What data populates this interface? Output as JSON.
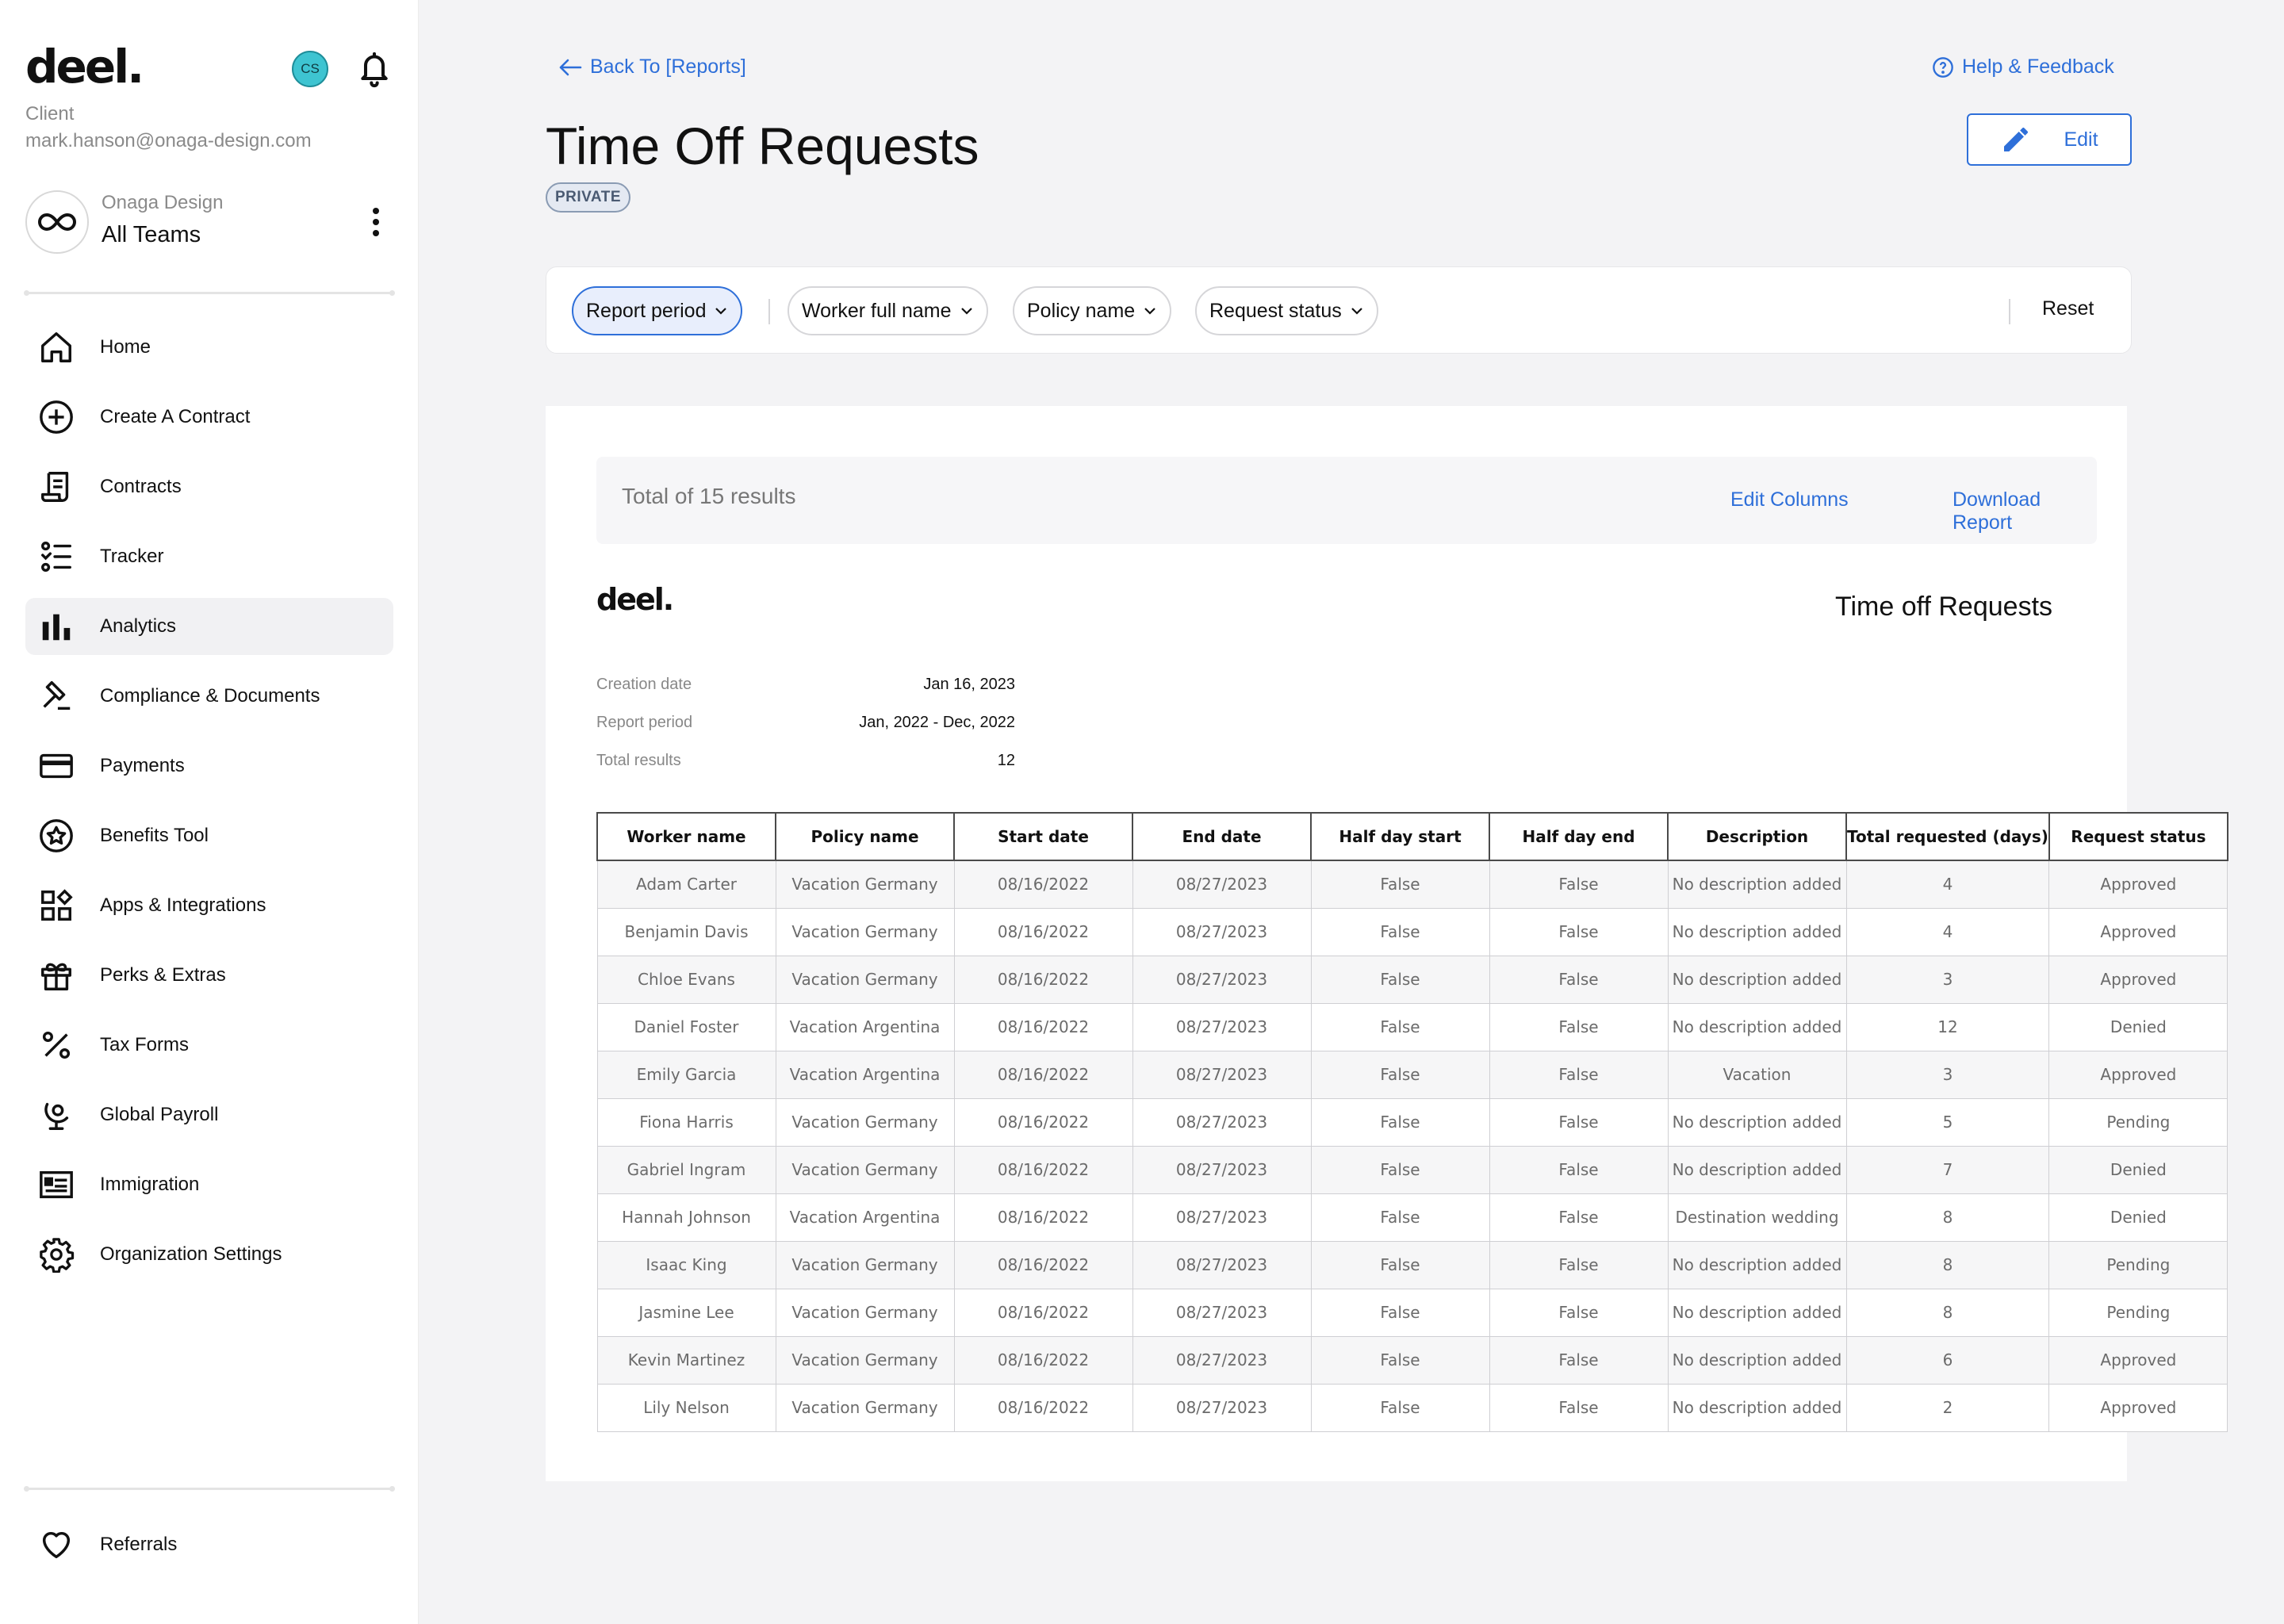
{
  "sidebar": {
    "logo": "deel.",
    "avatar_initials": "CS",
    "role": "Client",
    "email": "mark.hanson@onaga-design.com",
    "team": {
      "org": "Onaga Design",
      "name": "All Teams"
    },
    "nav": [
      {
        "label": "Home",
        "icon": "home-icon"
      },
      {
        "label": "Create A Contract",
        "icon": "plus-circle-icon"
      },
      {
        "label": "Contracts",
        "icon": "scroll-icon"
      },
      {
        "label": "Tracker",
        "icon": "checklist-icon"
      },
      {
        "label": "Analytics",
        "icon": "bar-chart-icon",
        "active": true
      },
      {
        "label": "Compliance & Documents",
        "icon": "gavel-icon"
      },
      {
        "label": "Payments",
        "icon": "credit-card-icon"
      },
      {
        "label": "Benefits Tool",
        "icon": "star-badge-icon"
      },
      {
        "label": "Apps & Integrations",
        "icon": "apps-grid-icon"
      },
      {
        "label": "Perks & Extras",
        "icon": "gift-icon"
      },
      {
        "label": "Tax Forms",
        "icon": "percent-icon"
      },
      {
        "label": "Global Payroll",
        "icon": "globe-pin-icon"
      },
      {
        "label": "Immigration",
        "icon": "id-card-icon"
      },
      {
        "label": "Organization Settings",
        "icon": "gear-icon"
      }
    ],
    "referrals": "Referrals"
  },
  "header": {
    "back_label": "Back To [Reports]",
    "help_label": "Help & Feedback",
    "title": "Time Off Requests",
    "badge": "PRIVATE",
    "edit_label": "Edit"
  },
  "filters": {
    "chips": [
      "Report period",
      "Worker full name",
      "Policy name",
      "Request status"
    ],
    "reset_label": "Reset"
  },
  "report": {
    "total_results_text": "Total of 15 results",
    "edit_columns_label": "Edit Columns",
    "download_label": "Download Report",
    "logo": "deel.",
    "title": "Time off Requests",
    "meta": [
      {
        "label": "Creation date",
        "value": "Jan 16, 2023"
      },
      {
        "label": "Report period",
        "value": "Jan, 2022 - Dec, 2022"
      },
      {
        "label": "Total results",
        "value": "12"
      }
    ],
    "columns": [
      "Worker name",
      "Policy name",
      "Start date",
      "End date",
      "Half day start",
      "Half day end",
      "Description",
      "Total requested (days)",
      "Request status"
    ],
    "rows": [
      [
        "Adam Carter",
        "Vacation Germany",
        "08/16/2022",
        "08/27/2023",
        "False",
        "False",
        "No description added",
        "4",
        "Approved"
      ],
      [
        "Benjamin Davis",
        "Vacation Germany",
        "08/16/2022",
        "08/27/2023",
        "False",
        "False",
        "No description added",
        "4",
        "Approved"
      ],
      [
        "Chloe Evans",
        "Vacation Germany",
        "08/16/2022",
        "08/27/2023",
        "False",
        "False",
        "No description added",
        "3",
        "Approved"
      ],
      [
        "Daniel Foster",
        "Vacation Argentina",
        "08/16/2022",
        "08/27/2023",
        "False",
        "False",
        "No description added",
        "12",
        "Denied"
      ],
      [
        "Emily Garcia",
        "Vacation Argentina",
        "08/16/2022",
        "08/27/2023",
        "False",
        "False",
        "Vacation",
        "3",
        "Approved"
      ],
      [
        "Fiona Harris",
        "Vacation Germany",
        "08/16/2022",
        "08/27/2023",
        "False",
        "False",
        "No description added",
        "5",
        "Pending"
      ],
      [
        "Gabriel Ingram",
        "Vacation Germany",
        "08/16/2022",
        "08/27/2023",
        "False",
        "False",
        "No description added",
        "7",
        "Denied"
      ],
      [
        "Hannah Johnson",
        "Vacation Argentina",
        "08/16/2022",
        "08/27/2023",
        "False",
        "False",
        "Destination wedding",
        "8",
        "Denied"
      ],
      [
        "Isaac King",
        "Vacation Germany",
        "08/16/2022",
        "08/27/2023",
        "False",
        "False",
        "No description added",
        "8",
        "Pending"
      ],
      [
        "Jasmine Lee",
        "Vacation Germany",
        "08/16/2022",
        "08/27/2023",
        "False",
        "False",
        "No description added",
        "8",
        "Pending"
      ],
      [
        "Kevin Martinez",
        "Vacation Germany",
        "08/16/2022",
        "08/27/2023",
        "False",
        "False",
        "No description added",
        "6",
        "Approved"
      ],
      [
        "Lily Nelson",
        "Vacation Germany",
        "08/16/2022",
        "08/27/2023",
        "False",
        "False",
        "No description added",
        "2",
        "Approved"
      ]
    ]
  },
  "colors": {
    "accent": "#2e6fd9",
    "avatar": "#3ec4d1",
    "active_nav_bg": "#f1f1f3",
    "page_bg": "#f3f3f5"
  }
}
